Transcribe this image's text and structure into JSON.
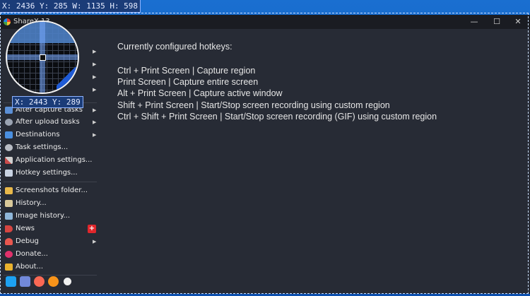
{
  "capture_readout": "X: 2436 Y: 285 W: 1135 H: 598",
  "cursor_readout": "X: 2443 Y: 289",
  "window": {
    "title": "ShareX 13",
    "controls": {
      "minimize": "—",
      "maximize": "☐",
      "close": "✕"
    }
  },
  "sidebar": {
    "items": [
      {
        "label": "After capture tasks",
        "arrow": "▶"
      },
      {
        "label": "After upload tasks",
        "arrow": "▶"
      },
      {
        "label": "Destinations",
        "arrow": "▶"
      },
      {
        "label": "Task settings..."
      },
      {
        "label": "Application settings..."
      },
      {
        "label": "Hotkey settings..."
      },
      {
        "label": "Screenshots folder..."
      },
      {
        "label": "History..."
      },
      {
        "label": "Image history..."
      },
      {
        "label": "News",
        "badge": "+"
      },
      {
        "label": "Debug",
        "arrow": "▶"
      },
      {
        "label": "Donate..."
      },
      {
        "label": "About..."
      }
    ],
    "upper_arrows": [
      "▶",
      "▶",
      "▶",
      "▶"
    ]
  },
  "content": {
    "header": "Currently configured hotkeys:",
    "hotkeys": [
      "Ctrl + Print Screen  |  Capture region",
      "Print Screen  |  Capture entire screen",
      "Alt + Print Screen  |  Capture active window",
      "Shift + Print Screen  |  Start/Stop screen recording using custom region",
      "Ctrl + Shift + Print Screen  |  Start/Stop screen recording (GIF) using custom region"
    ]
  },
  "social_icons": [
    "twitter-icon",
    "discord-icon",
    "patreon-icon",
    "bitcoin-icon",
    "github-icon"
  ],
  "colors": {
    "window_bg": "#272b35",
    "titlebar_bg": "#1a1c22",
    "desktop": "#0f5fc2",
    "news_badge": "#e0262b"
  }
}
